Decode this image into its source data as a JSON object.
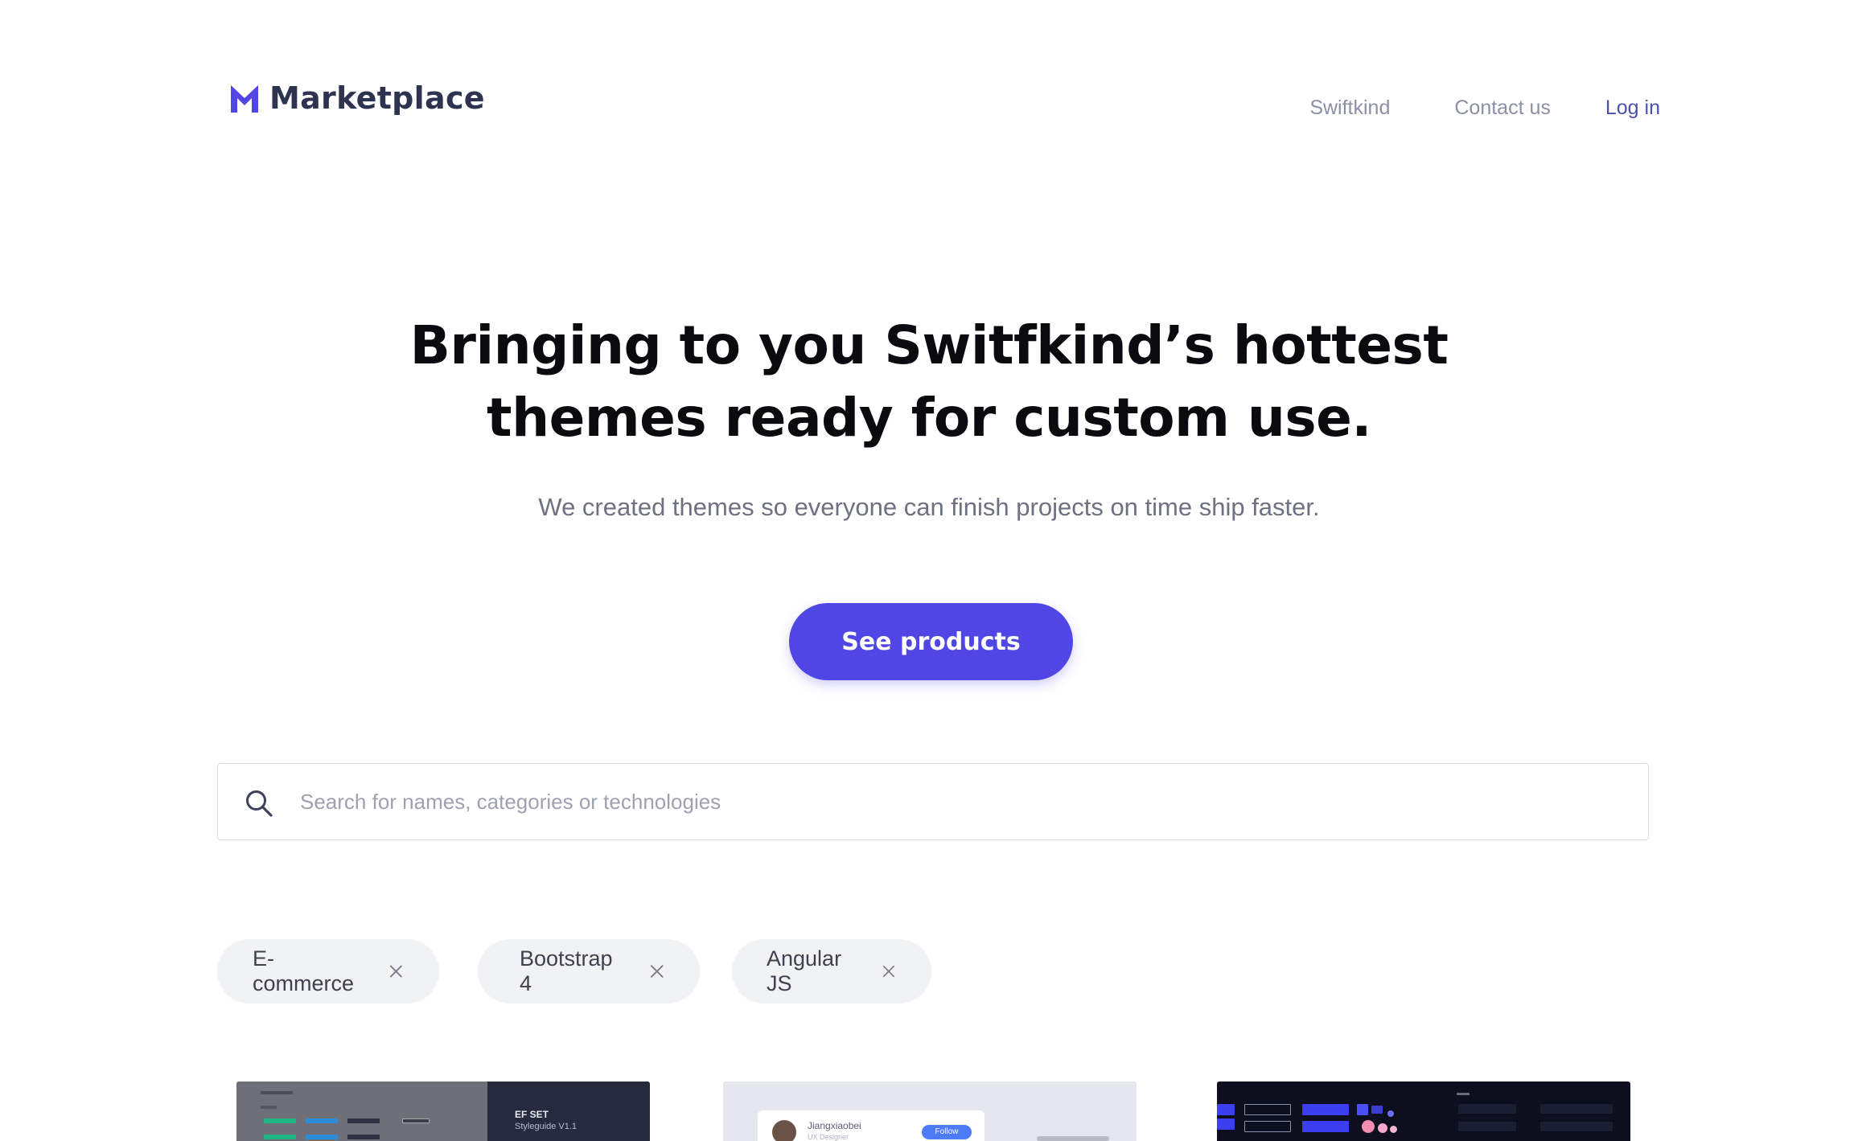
{
  "brand": {
    "name": "Marketplace",
    "accent": "#4f46e5"
  },
  "nav": {
    "items": [
      "Swiftkind",
      "Contact us"
    ],
    "login": "Log in"
  },
  "hero": {
    "title_line1": "Bringing to you Switfkind’s hottest",
    "title_line2": "themes ready for custom use.",
    "subtitle": "We created themes so everyone can finish projects on time ship faster.",
    "cta": "See products"
  },
  "search": {
    "placeholder": "Search for names, categories or technologies",
    "value": ""
  },
  "filters": [
    {
      "label": "E-commerce"
    },
    {
      "label": "Bootstrap 4"
    },
    {
      "label": "Angular JS"
    }
  ],
  "cards": [
    {
      "title": "EF SET",
      "subtitle": "Styleguide V1.1"
    },
    {
      "name": "Jiangxiaobei",
      "role": "UX Designer",
      "button": "Follow"
    },
    {
      "theme": "dark"
    }
  ]
}
